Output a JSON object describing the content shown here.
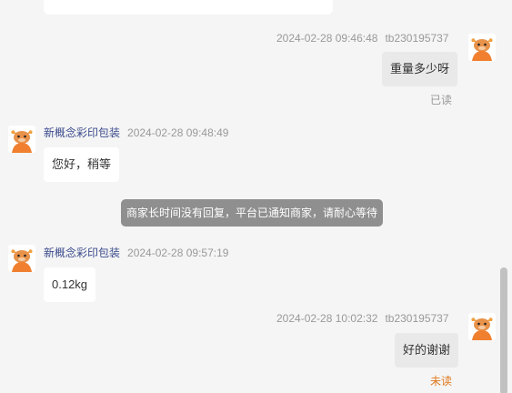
{
  "messages": [
    {
      "direction": "out",
      "time": "2024-02-28 09:46:48",
      "user": "tb230195737",
      "text": "重量多少呀",
      "status": "已读"
    },
    {
      "direction": "in",
      "sender": "新概念彩印包装",
      "time": "2024-02-28 09:48:49",
      "text": "您好，稍等"
    },
    {
      "direction": "in",
      "sender": "新概念彩印包装",
      "time": "2024-02-28 09:57:19",
      "text": "0.12kg"
    },
    {
      "direction": "out",
      "time": "2024-02-28 10:02:32",
      "user": "tb230195737",
      "text": "好的谢谢",
      "status": "未读"
    }
  ],
  "system_notice": "商家长时间没有回复，平台已通知商家，请耐心等待",
  "colors": {
    "background": "#f5f5f5",
    "incoming_bubble": "#ffffff",
    "outgoing_bubble": "#e9e9e9",
    "sender_name": "#3a4a8c",
    "unread": "#e07a1f",
    "read": "#999999",
    "notice_bg": "#8f8f8f"
  },
  "icons": {
    "avatar": "cartoon-cow-avatar-icon"
  }
}
